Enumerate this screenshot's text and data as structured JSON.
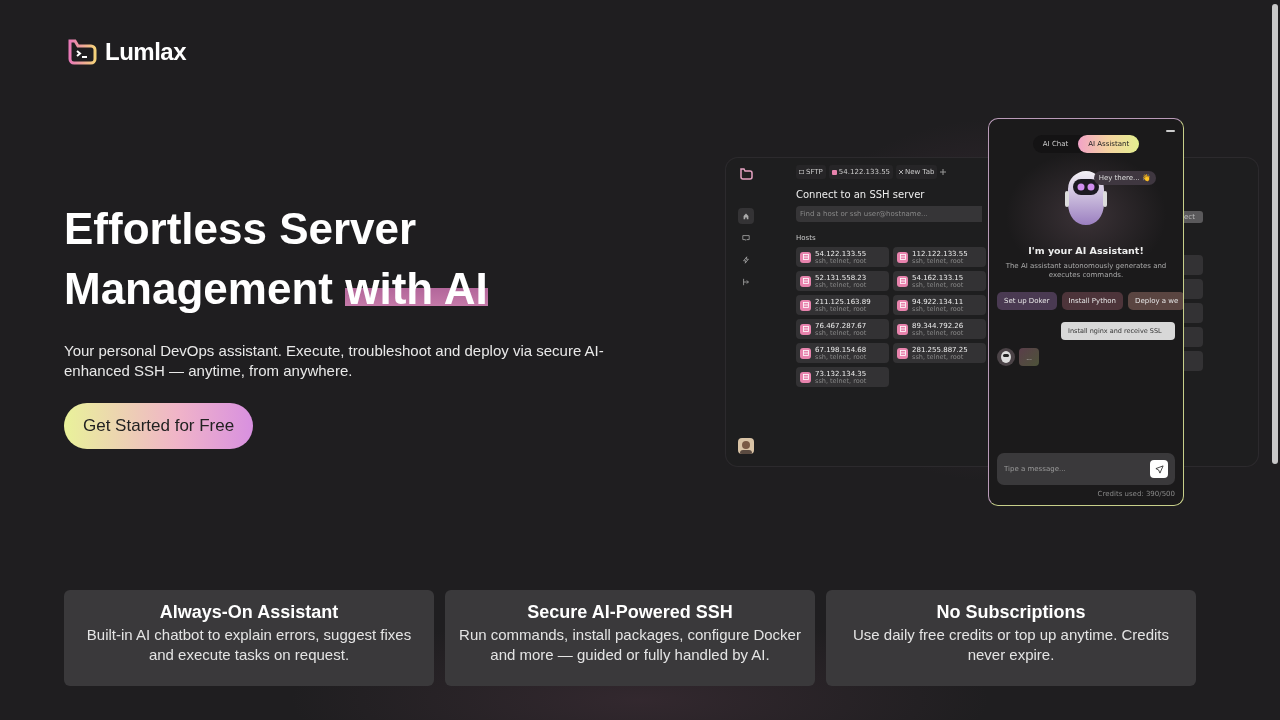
{
  "brand": {
    "name": "Lumlax"
  },
  "hero": {
    "title_line_1": "Effortless Server",
    "title_line_2": "Management",
    "title_highlight": "with AI",
    "subtitle": "Your personal DevOps assistant. Execute, troubleshoot and deploy via secure AI-enhanced SSH — anytime, from anywhere.",
    "cta": "Get Started for Free"
  },
  "app": {
    "nav": [
      {
        "kind": "home",
        "selected": true
      },
      {
        "kind": "terminal",
        "selected": false
      },
      {
        "kind": "bolt",
        "selected": false
      },
      {
        "kind": "logout",
        "selected": false
      }
    ],
    "tabs": [
      {
        "kind": "folder",
        "label": "SFTP"
      },
      {
        "kind": "host",
        "label": "54.122.133.55"
      },
      {
        "kind": "close",
        "label": "New Tab"
      }
    ],
    "heading": "Connect to an SSH server",
    "search": {
      "placeholder": "Find a host or ssh user@hostname..."
    },
    "connect_button": "ect",
    "hosts_label": "Hosts",
    "hosts": [
      {
        "ip": "54.122.133.55",
        "meta": "ssh, telnet, root"
      },
      {
        "ip": "112.122.133.55",
        "meta": "ssh, telnet, root"
      },
      {
        "ip": "52.131.558.23",
        "meta": "ssh, telnet, root"
      },
      {
        "ip": "54.162.133.15",
        "meta": "ssh, telnet, root"
      },
      {
        "ip": "211.125.163.89",
        "meta": "ssh, telnet, root"
      },
      {
        "ip": "94.922.134.11",
        "meta": "ssh, telnet, root"
      },
      {
        "ip": "76.467.287.67",
        "meta": "ssh, telnet, root"
      },
      {
        "ip": "89.344.792.26",
        "meta": "ssh, telnet, root"
      },
      {
        "ip": "67.198.154.68",
        "meta": "ssh, telnet, root"
      },
      {
        "ip": "281.255.887.25",
        "meta": "ssh, telnet, root"
      },
      {
        "ip": "73.132.134.35",
        "meta": "ssh, telnet, root"
      }
    ]
  },
  "assistant": {
    "tabs": [
      {
        "label": "AI Chat",
        "selected": false
      },
      {
        "label": "AI Assistant",
        "selected": true
      }
    ],
    "greeting": "Hey there... 👋",
    "title": "I'm your AI Assistant!",
    "description": "The AI assistant autonomously generates and executes commands.",
    "suggestions": [
      {
        "label": "Set up Doker",
        "color": "#4a3a52"
      },
      {
        "label": "Install Python",
        "color": "#4d343a"
      },
      {
        "label": "Deploy a we",
        "color": "#5a4541"
      }
    ],
    "messages": [
      {
        "kind": "user",
        "text": "Install nginx and receive SSL"
      },
      {
        "kind": "bot",
        "text": "..."
      }
    ],
    "input": {
      "placeholder": "Tipe a message..."
    },
    "credits": "Credits used: 390/500"
  },
  "features": [
    {
      "title": "Always-On Assistant",
      "text": "Built-in AI chatbot to explain errors, suggest fixes and execute tasks on request."
    },
    {
      "title": "Secure AI-Powered SSH",
      "text": "Run commands, install packages, configure Docker and more — guided or fully handled by AI."
    },
    {
      "title": "No Subscriptions",
      "text": "Use daily free credits or top up anytime. Credits never expire."
    }
  ]
}
